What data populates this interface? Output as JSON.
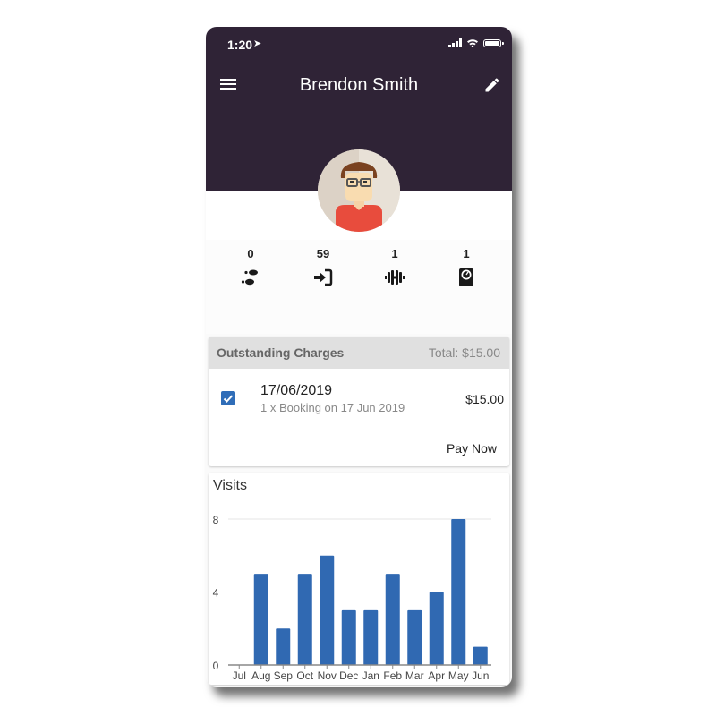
{
  "status_bar": {
    "time": "1:20",
    "location_icon": "location-arrow-icon",
    "icons": [
      "signal-icon",
      "wifi-icon",
      "battery-icon"
    ]
  },
  "header": {
    "title": "Brendon Smith",
    "menu_icon": "hamburger-menu-icon",
    "edit_icon": "pencil-edit-icon",
    "background": "#2f2336"
  },
  "profile": {
    "avatar": "avatar-illustration"
  },
  "stats": [
    {
      "value": "0",
      "icon": "footsteps-icon"
    },
    {
      "value": "59",
      "icon": "sign-in-icon"
    },
    {
      "value": "1",
      "icon": "dumbbell-icon"
    },
    {
      "value": "1",
      "icon": "weight-scale-icon"
    }
  ],
  "outstanding_charges": {
    "title": "Outstanding Charges",
    "total": "Total: $15.00",
    "items": [
      {
        "checked": true,
        "date": "17/06/2019",
        "description": "1 x Booking on 17 Jun 2019",
        "amount": "$15.00"
      }
    ],
    "pay_now_label": "Pay Now"
  },
  "visits": {
    "title": "Visits"
  },
  "colors": {
    "accent": "#2f6db8",
    "header": "#2f2336"
  },
  "chart_data": {
    "type": "bar",
    "title": "Visits",
    "categories": [
      "Jul",
      "Aug",
      "Sep",
      "Oct",
      "Nov",
      "Dec",
      "Jan",
      "Feb",
      "Mar",
      "Apr",
      "May",
      "Jun"
    ],
    "values": [
      0,
      5,
      2,
      5,
      6,
      3,
      3,
      5,
      3,
      4,
      8,
      1
    ],
    "xlabel": "",
    "ylabel": "",
    "ylim": [
      0,
      8
    ],
    "yticks": [
      0,
      4,
      8
    ],
    "grid": true,
    "legend": "none",
    "color": "#3069b2"
  }
}
